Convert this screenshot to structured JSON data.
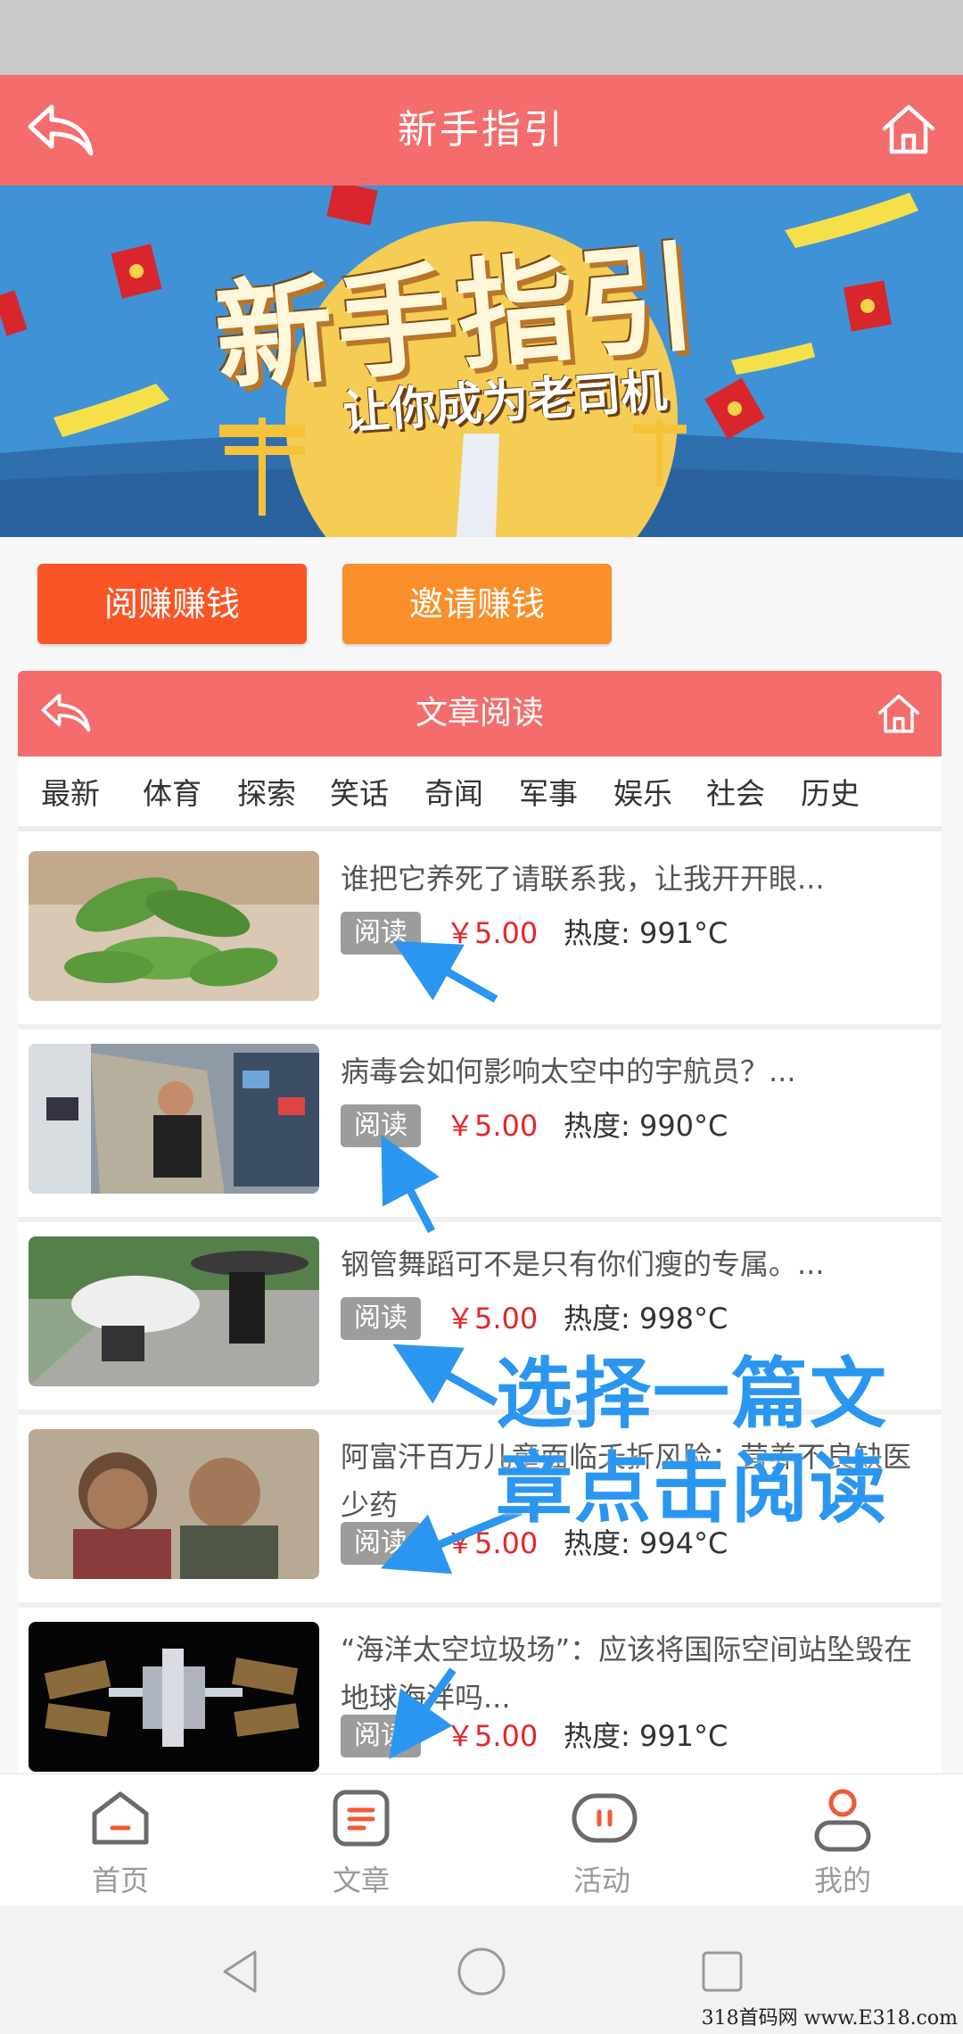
{
  "header": {
    "title": "新手指引"
  },
  "banner": {
    "headline": "新手指引",
    "subline": "让你成为老司机"
  },
  "actions": {
    "read_label": "阅赚赚钱",
    "invite_label": "邀请赚钱"
  },
  "inner": {
    "title": "文章阅读",
    "tabs": [
      "最新",
      "体育",
      "探索",
      "笑话",
      "奇闻",
      "军事",
      "娱乐",
      "社会",
      "历史"
    ]
  },
  "articles": [
    {
      "title": "谁把它养死了请联系我，让我开开眼...",
      "tag": "阅读",
      "price": "￥5.00",
      "heat": "热度: 991°C"
    },
    {
      "title": "病毒会如何影响太空中的宇航员？...",
      "tag": "阅读",
      "price": "￥5.00",
      "heat": "热度: 990°C"
    },
    {
      "title": "钢管舞蹈可不是只有你们瘦的专属。...",
      "tag": "阅读",
      "price": "￥5.00",
      "heat": "热度: 998°C"
    },
    {
      "title": "阿富汗百万儿童面临夭折风险：营养不良缺医少药",
      "tag": "阅读",
      "price": "￥5.00",
      "heat": "热度: 994°C"
    },
    {
      "title": "“海洋太空垃圾场”：应该将国际空间站坠毁在地球海洋吗...",
      "tag": "阅读",
      "price": "￥5.00",
      "heat": "热度: 991°C"
    }
  ],
  "annotation": {
    "line1": "选择一篇文",
    "line2": "章点击阅读"
  },
  "bottom_nav": [
    {
      "label": "首页",
      "icon": "home-icon"
    },
    {
      "label": "文章",
      "icon": "article-icon"
    },
    {
      "label": "活动",
      "icon": "activity-icon"
    },
    {
      "label": "我的",
      "icon": "profile-icon"
    }
  ],
  "watermark": "318首码网 www.E318.com",
  "colors": {
    "header": "#f46c6c",
    "read_button": "#fa5526",
    "invite_button": "#f88f2a",
    "price": "#e5252a",
    "annotation": "#2b96f0"
  }
}
